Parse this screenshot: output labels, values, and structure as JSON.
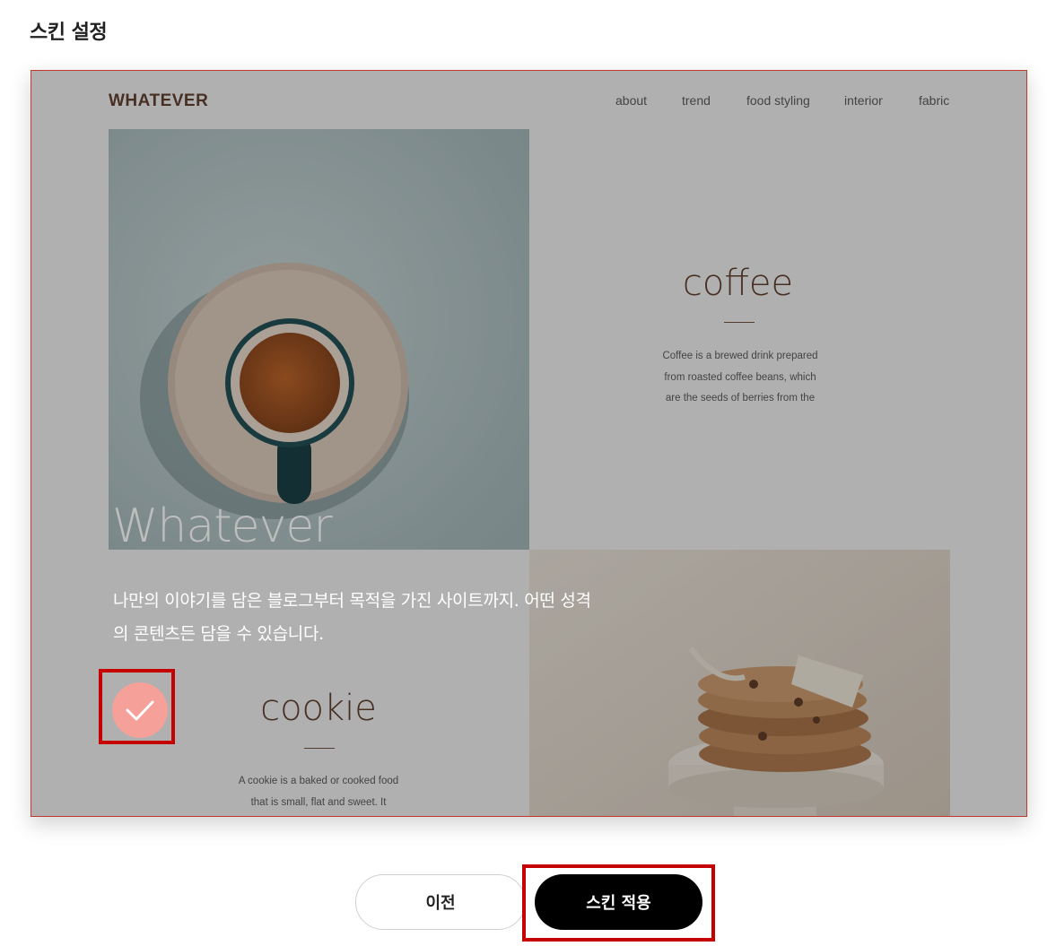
{
  "page": {
    "title": "스킨 설정"
  },
  "preview": {
    "brand": "WHATEVER",
    "nav": [
      "about",
      "trend",
      "food styling",
      "interior",
      "fabric"
    ],
    "coffee": {
      "title": "coffee",
      "lines": [
        "Coffee is a brewed drink prepared",
        "from roasted coffee beans, which",
        "are the seeds of berries from the"
      ]
    },
    "cookie": {
      "title": "cookie",
      "lines": [
        "A cookie is a baked or cooked food",
        "that is small, flat and sweet. It"
      ]
    },
    "hero": {
      "title": "Whatever",
      "desc_line1": "나만의 이야기를 담은 블로그부터 목적을 가진 사이트까지. 어떤 성격",
      "desc_line2": "의 콘텐츠든 담을 수 있습니다."
    },
    "check_icon": "check-icon"
  },
  "buttons": {
    "prev": "이전",
    "apply": "스킨 적용"
  },
  "colors": {
    "highlight": "#c40000",
    "check": "#f6a09a",
    "brand": "#5a3a2a",
    "apply_bg": "#000000"
  }
}
